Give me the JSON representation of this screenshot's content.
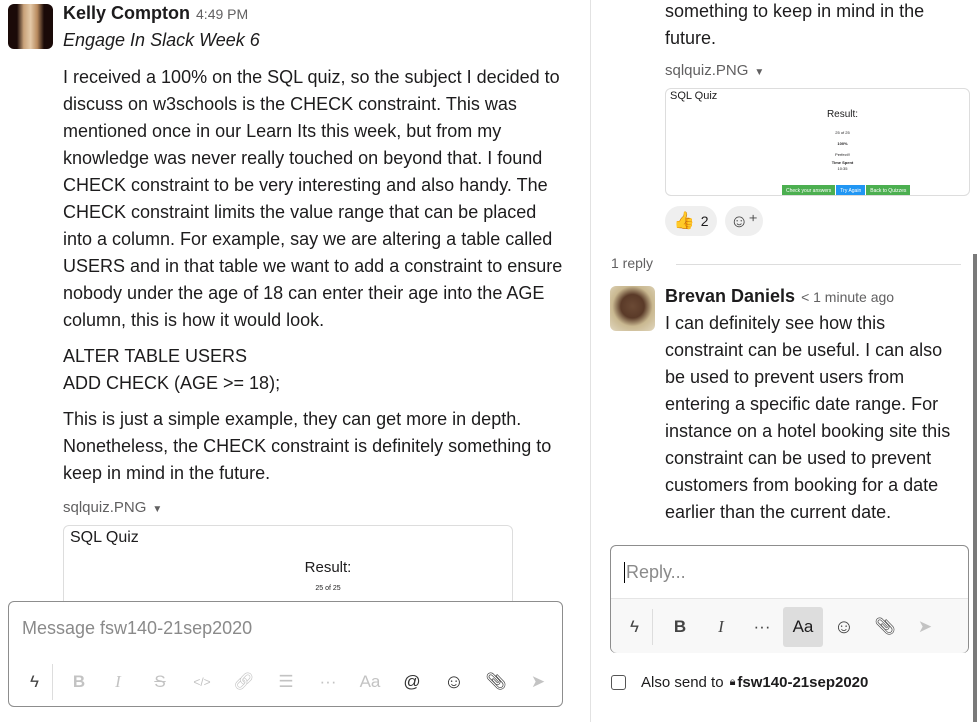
{
  "main": {
    "author": "Kelly Compton",
    "time": "4:49 PM",
    "subtitle": "Engage In Slack Week 6",
    "paragraphs": [
      "I received a 100% on the SQL quiz, so the subject I decided to discuss on w3schools is the CHECK constraint. This was mentioned once in our Learn Its this week, but from my knowledge was never really touched on beyond that. I found CHECK constraint to be very interesting and also handy. The CHECK constraint limits the value range that can be placed into a column. For example, say we are altering a table called USERS and in that table we want to add a constraint to ensure nobody under the age of 18 can enter their age into the AGE column, this is how it would look.",
      "ALTER TABLE USERS",
      "ADD CHECK (AGE >= 18);",
      "This is just a simple example, they can get more in depth. Nonetheless, the CHECK constraint is definitely something to keep in mind in the future."
    ],
    "file_name": "sqlquiz.PNG",
    "composer_placeholder": "Message fsw140-21sep2020"
  },
  "quiz": {
    "title": "SQL Quiz",
    "result": "Result:",
    "score": "25 of 25",
    "percent": "100%",
    "remark": "Perfect!!",
    "time_label": "Time Spent",
    "time_value": "10:35",
    "buttons": [
      "Check your answers",
      "Try Again",
      "Back to Quizzes"
    ]
  },
  "thread": {
    "top_text_1": "something to keep in mind in the",
    "top_text_2": "future.",
    "file_name": "sqlquiz.PNG",
    "reaction_emoji": "👍",
    "reaction_count": "2",
    "reply_count": "1 reply",
    "reply_author": "Brevan Daniels",
    "reply_time": "< 1 minute ago",
    "reply_text": "I can definitely see how this constraint can be useful. I can also be used to prevent users from entering a specific date range. For instance on a hotel booking site this constraint can be used to prevent customers from booking for a date earlier than the current date.",
    "reply_placeholder": "Reply...",
    "also_send_label": "Also send to",
    "channel": "fsw140-21sep2020"
  },
  "icons": {
    "bold": "B",
    "italic": "I",
    "more": "···",
    "format": "Aa",
    "at": "@",
    "emoji": "☺",
    "send": "➤",
    "lock": "🔒"
  }
}
